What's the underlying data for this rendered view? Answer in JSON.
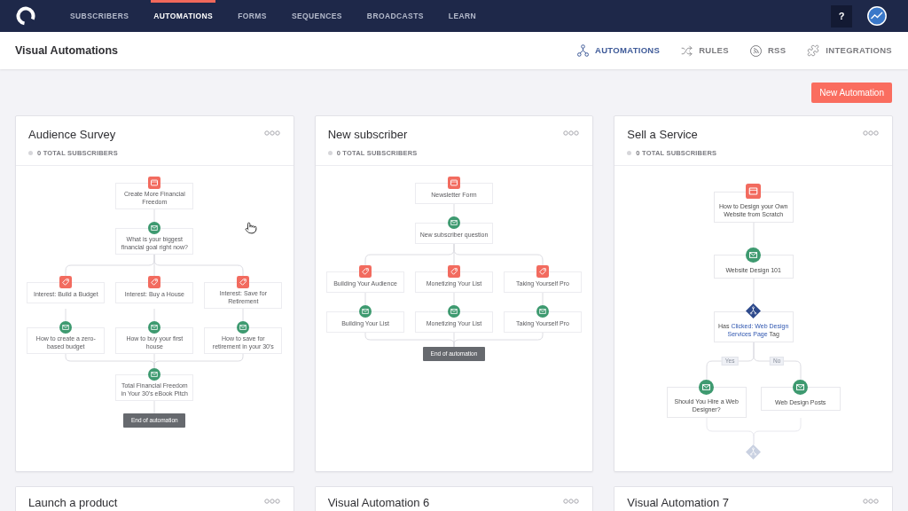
{
  "nav": {
    "items": [
      {
        "label": "SUBSCRIBERS",
        "selected": false
      },
      {
        "label": "AUTOMATIONS",
        "selected": true
      },
      {
        "label": "FORMS",
        "selected": false
      },
      {
        "label": "SEQUENCES",
        "selected": false
      },
      {
        "label": "BROADCASTS",
        "selected": false
      },
      {
        "label": "LEARN",
        "selected": false
      }
    ],
    "help_button": "?"
  },
  "header": {
    "title": "Visual Automations",
    "tabs": [
      {
        "label": "AUTOMATIONS",
        "kind": "automations",
        "selected": true
      },
      {
        "label": "RULES",
        "kind": "rules",
        "selected": false
      },
      {
        "label": "RSS",
        "kind": "rss",
        "selected": false
      },
      {
        "label": "INTEGRATIONS",
        "kind": "integrations",
        "selected": false
      }
    ]
  },
  "new_automation_button": "New Automation",
  "cards": [
    {
      "title": "Audience Survey",
      "subscribers": "0 TOTAL SUBSCRIBERS",
      "flow": {
        "rows": [
          [
            {
              "kind": "form",
              "text": "Create More Financial Freedom"
            }
          ],
          [
            {
              "kind": "email",
              "text": "What is your biggest financial goal right now?"
            }
          ],
          [
            {
              "kind": "tag",
              "text": "Interest: Build a Budget"
            },
            {
              "kind": "tag",
              "text": "Interest: Buy a House"
            },
            {
              "kind": "tag",
              "text": "Interest: Save for Retirement"
            }
          ],
          [
            {
              "kind": "email",
              "text": "How to create a zero-based budget"
            },
            {
              "kind": "email",
              "text": "How to buy your first house"
            },
            {
              "kind": "email",
              "text": "How to save for retirement in your 30's"
            }
          ],
          [
            {
              "kind": "email",
              "text": "Total Financial Freedom in Your 30's eBook Pitch"
            }
          ],
          [
            {
              "kind": "end",
              "text": "End of automation"
            }
          ]
        ]
      }
    },
    {
      "title": "New subscriber",
      "subscribers": "0 TOTAL SUBSCRIBERS",
      "flow": {
        "rows": [
          [
            {
              "kind": "form",
              "text": "Newsletter Form"
            }
          ],
          [
            {
              "kind": "email",
              "text": "New subscriber question"
            }
          ],
          [
            {
              "kind": "tag",
              "text": "Building Your Audience"
            },
            {
              "kind": "tag",
              "text": "Monetizing Your List"
            },
            {
              "kind": "tag",
              "text": "Taking Yourself Pro"
            }
          ],
          [
            {
              "kind": "email",
              "text": "Building Your List"
            },
            {
              "kind": "email",
              "text": "Monetizing Your List"
            },
            {
              "kind": "email",
              "text": "Taking Yourself Pro"
            }
          ],
          [
            {
              "kind": "end",
              "text": "End of automation"
            }
          ]
        ]
      }
    },
    {
      "title": "Sell a Service",
      "subscribers": "0 TOTAL SUBSCRIBERS",
      "flow": {
        "rows": [
          [
            {
              "kind": "form",
              "text": "How to Design your Own Website from Scratch",
              "faded": false
            }
          ],
          [
            {
              "kind": "email",
              "text": "Website Design 101",
              "faded": false
            }
          ],
          [
            {
              "kind": "condition",
              "faded": false,
              "parts": [
                {
                  "text": "Has",
                  "highlight": false
                },
                {
                  "text": "Clicked: Web Design Services Page",
                  "highlight": true
                },
                {
                  "text": "Tag",
                  "highlight": false
                }
              ]
            }
          ],
          [
            {
              "kind": "email",
              "text": "Should You Hire a Web Designer?",
              "branch_label": "Yes",
              "faded": false
            },
            {
              "kind": "email",
              "text": "Web Design Posts",
              "branch_label": "No",
              "faded": false
            }
          ],
          [
            {
              "kind": "condition",
              "faded": true
            }
          ]
        ]
      }
    },
    {
      "title": "Launch a product"
    },
    {
      "title": "Visual Automation 6"
    },
    {
      "title": "Visual Automation 7"
    }
  ]
}
